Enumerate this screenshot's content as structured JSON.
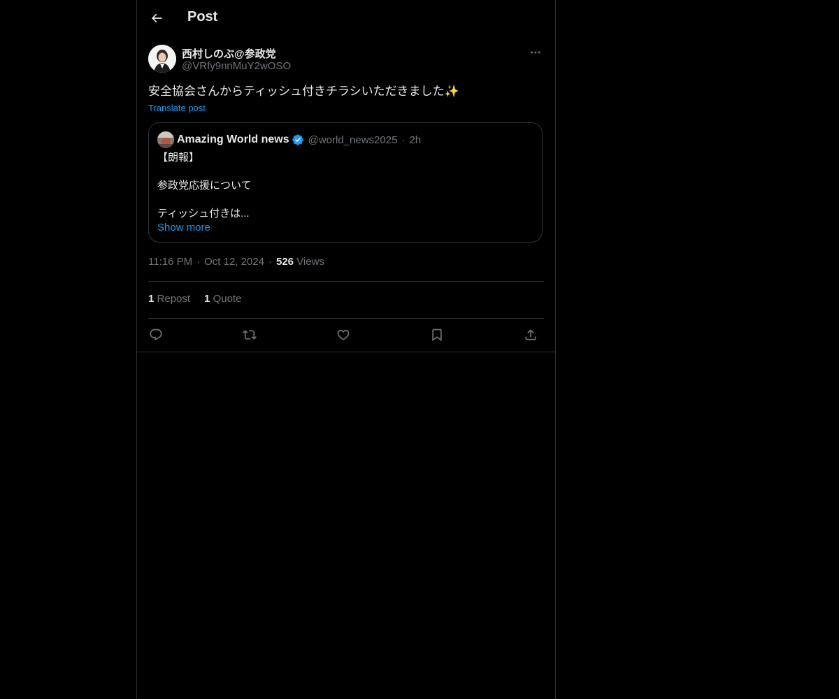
{
  "header": {
    "title": "Post"
  },
  "author": {
    "name": "西村しのぶ@参政党",
    "handle": "@VRfy9nnMuY2wOSO"
  },
  "post": {
    "text": "安全協会さんからティッシュ付きチラシいただきました✨",
    "translate_label": "Translate post"
  },
  "quote": {
    "name": "Amazing World news",
    "handle": "@world_news2025",
    "separator": "·",
    "time": "2h",
    "lines": [
      "【朗報】",
      "参政党応援について",
      "ティッシュ付きは..."
    ],
    "show_more": "Show more"
  },
  "meta": {
    "time": "11:16 PM",
    "date": "Oct 12, 2024",
    "separator": "·",
    "views_count": "526",
    "views_label": "Views"
  },
  "stats": {
    "reposts_count": "1",
    "reposts_label": "Repost",
    "quotes_count": "1",
    "quotes_label": "Quote"
  },
  "actions": [
    "reply-icon",
    "repost-icon",
    "like-icon",
    "bookmark-icon",
    "share-icon"
  ],
  "colors": {
    "background": "#000000",
    "text": "#e7e9ea",
    "muted": "#71767b",
    "accent": "#1d9bf0",
    "border": "#2f3336"
  }
}
